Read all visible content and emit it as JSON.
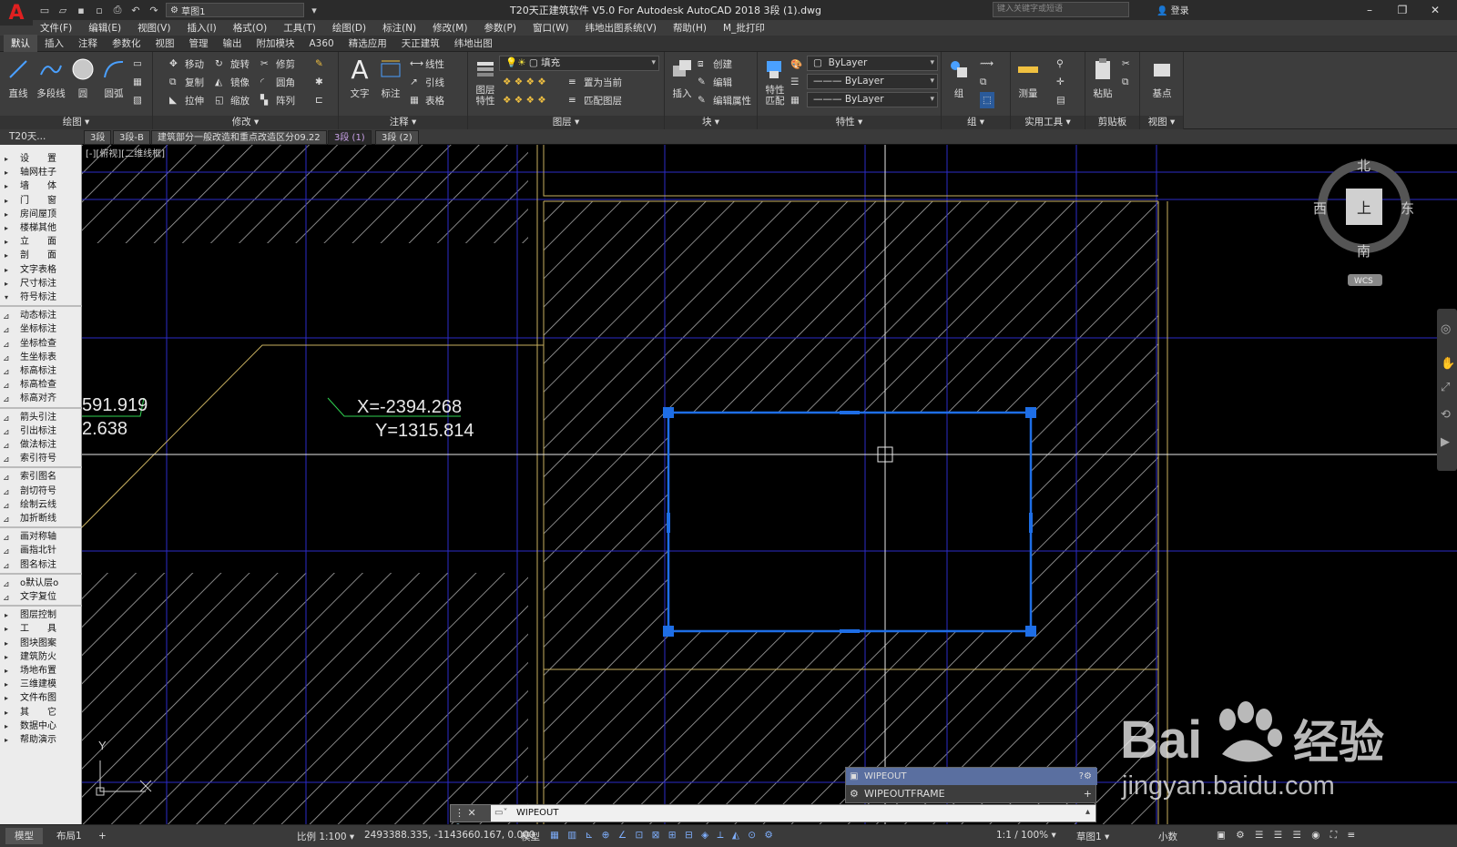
{
  "app": {
    "logo": "A",
    "workspace": "草图1",
    "title": "T20天正建筑软件 V5.0 For Autodesk AutoCAD 2018    3段 (1).dwg",
    "search_placeholder": "键入关键字或短语",
    "login": "登录"
  },
  "menu": [
    "文件(F)",
    "编辑(E)",
    "视图(V)",
    "插入(I)",
    "格式(O)",
    "工具(T)",
    "绘图(D)",
    "标注(N)",
    "修改(M)",
    "参数(P)",
    "窗口(W)",
    "纬地出图系统(V)",
    "帮助(H)",
    "M_批打印"
  ],
  "ribbon_tabs": [
    "默认",
    "插入",
    "注释",
    "参数化",
    "视图",
    "管理",
    "输出",
    "附加模块",
    "A360",
    "精选应用",
    "天正建筑",
    "纬地出图"
  ],
  "ribbon": {
    "draw": {
      "title": "绘图 ▾",
      "line": "直线",
      "polyline": "多段线",
      "circle": "圆",
      "arc": "圆弧"
    },
    "modify": {
      "title": "修改 ▾",
      "move": "移动",
      "rotate": "旋转",
      "trim": "修剪",
      "copy": "复制",
      "mirror": "镜像",
      "fillet": "圆角",
      "stretch": "拉伸",
      "scale": "缩放",
      "array": "阵列"
    },
    "annotation": {
      "title": "注释 ▾",
      "text": "文字",
      "dimension": "标注",
      "linear": "线性",
      "leader": "引线",
      "table": "表格"
    },
    "layers": {
      "title": "图层 ▾",
      "layer_props": "图层\n特性",
      "layer_name": "填充",
      "set_current": "置为当前",
      "match_layer": "匹配图层"
    },
    "block": {
      "title": "块 ▾",
      "insert": "插入",
      "create": "创建",
      "edit": "编辑",
      "edit_attr": "编辑属性"
    },
    "properties": {
      "title": "特性 ▾",
      "match": "特性\n匹配",
      "color": "ByLayer",
      "linetype": "ByLayer",
      "lineweight": "ByLayer"
    },
    "groups": {
      "title": "组 ▾",
      "group": "组"
    },
    "utilities": {
      "title": "实用工具 ▾",
      "measure": "测量"
    },
    "clipboard": {
      "title": "剪贴板",
      "paste": "粘贴"
    },
    "view": {
      "title": "视图 ▾",
      "base": "基点"
    }
  },
  "doc_tabs": {
    "left_label": "T20天...",
    "tabs": [
      "3段",
      "3段-B",
      "建筑部分一般改造和重点改造区分09.22",
      "3段 (1)",
      "3段 (2)"
    ]
  },
  "sidebar": {
    "group1": [
      "设　　置",
      "轴网柱子",
      "墙　　体",
      "门　　窗",
      "房间屋顶",
      "楼梯其他",
      "立　　面",
      "剖　　面",
      "文字表格",
      "尺寸标注",
      "符号标注"
    ],
    "group2": [
      "动态标注",
      "坐标标注",
      "坐标检查",
      "生坐标表",
      "标高标注",
      "标高检查",
      "标高对齐"
    ],
    "group3": [
      "箭头引注",
      "引出标注",
      "做法标注",
      "索引符号"
    ],
    "group4": [
      "索引图名",
      "剖切符号",
      "绘制云线",
      "加折断线"
    ],
    "group5": [
      "画对称轴",
      "画指北针",
      "图名标注"
    ],
    "group6": [
      "o默认层o",
      "文字复位"
    ],
    "group7": [
      "图层控制",
      "工　　具",
      "图块图案",
      "建筑防火",
      "场地布置",
      "三维建模",
      "文件布图",
      "其　　它",
      "数据中心",
      "帮助演示"
    ]
  },
  "canvas": {
    "viewport_label": "[-][俯视][二维线框]",
    "coord_left_x": "591.919",
    "coord_left_y": "2.638",
    "coord_x": "X=-2394.268",
    "coord_y": "Y=1315.814",
    "viewcube": {
      "north": "北",
      "south": "南",
      "west": "西",
      "east": "东",
      "top": "上",
      "wcs": "WCS"
    },
    "ucs_y": "Y"
  },
  "command": {
    "popup_items": [
      "WIPEOUT",
      "WIPEOUTFRAME"
    ],
    "input": "WIPEOUT"
  },
  "status": {
    "model_tab": "模型",
    "layout_tab": "布局1",
    "add_tab": "+",
    "scale": "比例 1:100 ▾",
    "coords": "2493388.335, -1143660.167, 0.000",
    "model": "模型",
    "annoscale": "1:1 / 100% ▾",
    "workspace": "草图1 ▾",
    "units": "小数"
  },
  "watermark": {
    "brand": "Bai",
    "brand2": "经验",
    "url": "jingyan.baidu.com"
  },
  "colors": {
    "selection": "#1e6ee6",
    "grid": "#2a2ad0",
    "accent": "#e02020",
    "yellow": "#c8b060"
  }
}
